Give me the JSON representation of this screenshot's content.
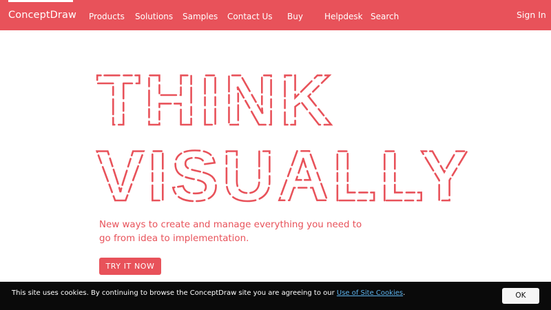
{
  "brand": {
    "name": "ConceptDraw",
    "accent": "#e8525a"
  },
  "nav": {
    "items": [
      {
        "label": "Products"
      },
      {
        "label": "Solutions"
      },
      {
        "label": "Samples"
      },
      {
        "label": "Contact Us"
      },
      {
        "label": "Buy"
      },
      {
        "label": "Helpdesk"
      },
      {
        "label": "Search"
      }
    ],
    "signin": "Sign In"
  },
  "hero": {
    "headline_line1": "THINK",
    "headline_line2": "VISUALLY",
    "subtitle": "New ways to create and manage everything you need to go from idea to implementation.",
    "cta": "TRY IT NOW"
  },
  "cookie": {
    "text": "This site uses cookies. By continuing to browse the ConceptDraw site you are agreeing to our",
    "link": "Use of Site Cookies",
    "after": ".",
    "ok": "OK"
  }
}
